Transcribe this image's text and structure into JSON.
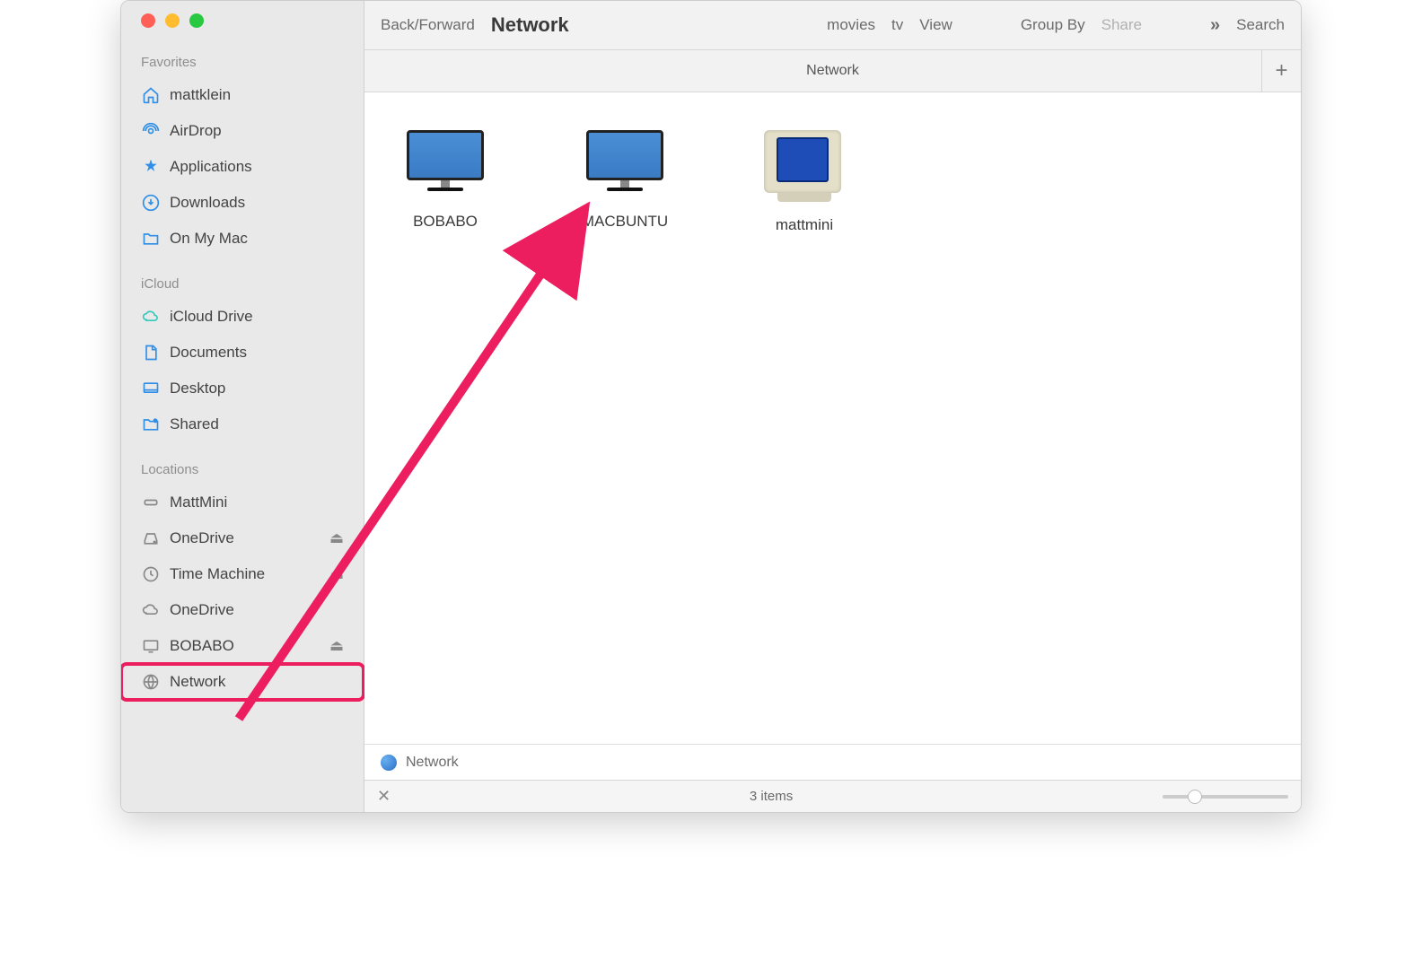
{
  "toolbar": {
    "back_forward": "Back/Forward",
    "title": "Network",
    "movies": "movies",
    "tv": "tv",
    "view": "View",
    "group_by": "Group By",
    "share": "Share",
    "search": "Search"
  },
  "tab": {
    "label": "Network"
  },
  "sidebar": {
    "favorites_label": "Favorites",
    "icloud_label": "iCloud",
    "locations_label": "Locations",
    "favorites": [
      {
        "label": "mattklein",
        "icon": "home"
      },
      {
        "label": "AirDrop",
        "icon": "airdrop"
      },
      {
        "label": "Applications",
        "icon": "apps"
      },
      {
        "label": "Downloads",
        "icon": "download"
      },
      {
        "label": "On My Mac",
        "icon": "folder"
      }
    ],
    "icloud": [
      {
        "label": "iCloud Drive",
        "icon": "cloud"
      },
      {
        "label": "Documents",
        "icon": "doc"
      },
      {
        "label": "Desktop",
        "icon": "desktop"
      },
      {
        "label": "Shared",
        "icon": "shared"
      }
    ],
    "locations": [
      {
        "label": "MattMini",
        "icon": "macmini",
        "eject": false
      },
      {
        "label": "OneDrive",
        "icon": "disk",
        "eject": true
      },
      {
        "label": "Time Machine",
        "icon": "time",
        "eject": true
      },
      {
        "label": "OneDrive",
        "icon": "cloud-gray",
        "eject": false
      },
      {
        "label": "BOBABO",
        "icon": "display",
        "eject": true
      },
      {
        "label": "Network",
        "icon": "globe",
        "eject": false,
        "highlighted": true
      }
    ]
  },
  "items": [
    {
      "label": "BOBABO",
      "type": "imac"
    },
    {
      "label": "MACBUNTU",
      "type": "imac"
    },
    {
      "label": "mattmini",
      "type": "crt"
    }
  ],
  "pathbar": {
    "label": "Network"
  },
  "statusbar": {
    "count": "3 items"
  }
}
